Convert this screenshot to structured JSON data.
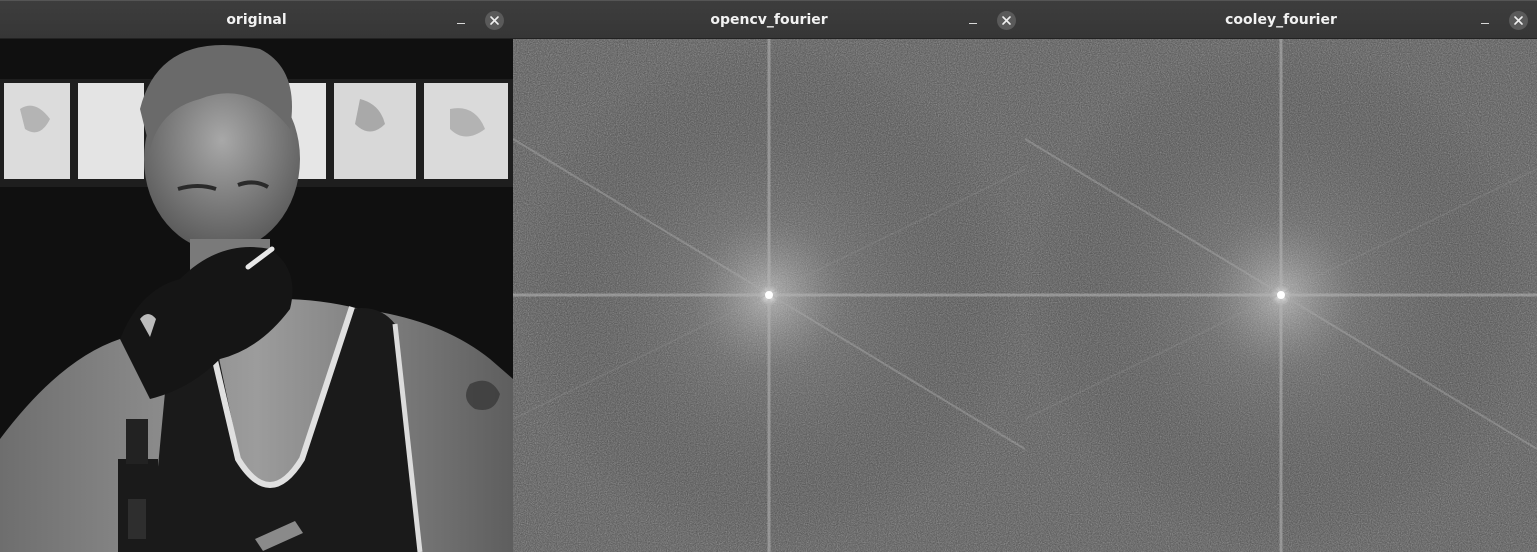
{
  "windows": [
    {
      "title": "original",
      "image": "photo-of-man-with-cigarette"
    },
    {
      "title": "opencv_fourier",
      "image": "fourier-magnitude-spectrum"
    },
    {
      "title": "cooley_fourier",
      "image": "fourier-magnitude-spectrum"
    }
  ],
  "icons": {
    "minimize": "minimize-icon",
    "close": "close-icon"
  },
  "colors": {
    "titlebar": "#383838",
    "title_text": "#f2f2f2",
    "close_circle": "#5a5a5a",
    "spectrum_bg": "#555555"
  }
}
